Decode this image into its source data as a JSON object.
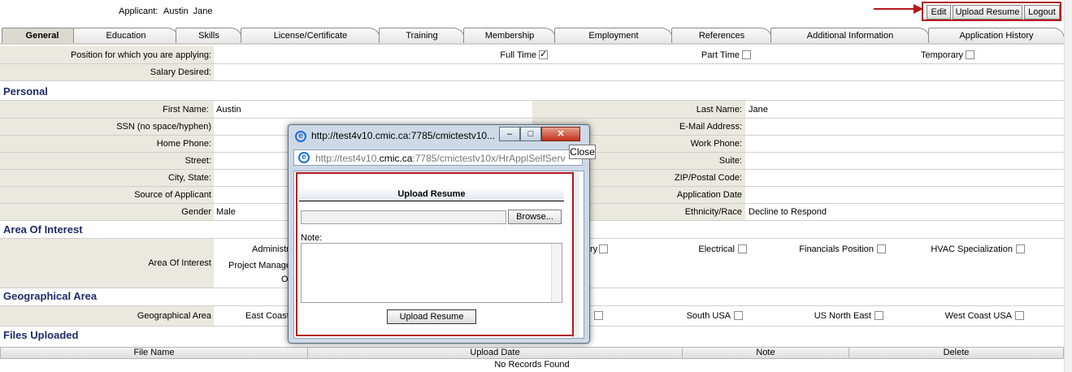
{
  "header": {
    "applicant_label": "Applicant:",
    "applicant_name": "Austin  Jane",
    "buttons": {
      "edit": "Edit",
      "upload_resume": "Upload Resume",
      "logout": "Logout"
    }
  },
  "tabs": [
    "General",
    "Education",
    "Skills",
    "License/Certificate",
    "Training",
    "Membership",
    "Employment",
    "References",
    "Additional Information",
    "Application History"
  ],
  "position": {
    "label": "Position for which you are applying:",
    "full_time": "Full Time",
    "part_time": "Part Time",
    "temporary": "Temporary",
    "salary_label": "Salary Desired:"
  },
  "personal": {
    "title": "Personal",
    "first_name_label": "First Name:",
    "first_name": "Austin",
    "last_name_label": "Last Name:",
    "last_name": "Jane",
    "ssn_label": "SSN (no space/hyphen)",
    "email_label": "E-Mail Address:",
    "home_phone_label": "Home Phone:",
    "work_phone_label": "Work Phone:",
    "street_label": "Street:",
    "suite_label": "Suite:",
    "city_label": "City, State:",
    "zip_label": "ZIP/Postal Code:",
    "source_label": "Source of Applicant",
    "app_date_label": "Application Date",
    "gender_label": "Gender",
    "gender": "Male",
    "ethnicity_label": "Ethnicity/Race",
    "ethnicity": "Decline to Respond"
  },
  "area_of_interest": {
    "title": "Area Of Interest",
    "label": "Area Of Interest",
    "partial_1": "Administr",
    "partial_2": "Project Manage",
    "partial_3": "O",
    "partial_4": "ry",
    "electrical": "Electrical",
    "financials": "Financials Position",
    "hvac": "HVAC Specialization"
  },
  "geo": {
    "title": "Geographical Area",
    "label": "Geographical Area",
    "east_coast": "East Coast",
    "south_usa": "South USA",
    "us_north_east": "US North East",
    "west_coast": "West Coast USA"
  },
  "files": {
    "title": "Files Uploaded",
    "columns": [
      "File Name",
      "Upload Date",
      "Note",
      "Delete"
    ],
    "empty": "No Records Found"
  },
  "popup": {
    "title": "http://test4v10.cmic.ca:7785/cmictestv10...",
    "address_prefix": "http://test4v10.",
    "address_host": "cmic.ca",
    "address_suffix": ":7785/cmictestv10x/HrApplSelfServ",
    "tooltip": "Close",
    "heading": "Upload Resume",
    "browse": "Browse...",
    "note_label": "Note:",
    "submit": "Upload Resume"
  }
}
